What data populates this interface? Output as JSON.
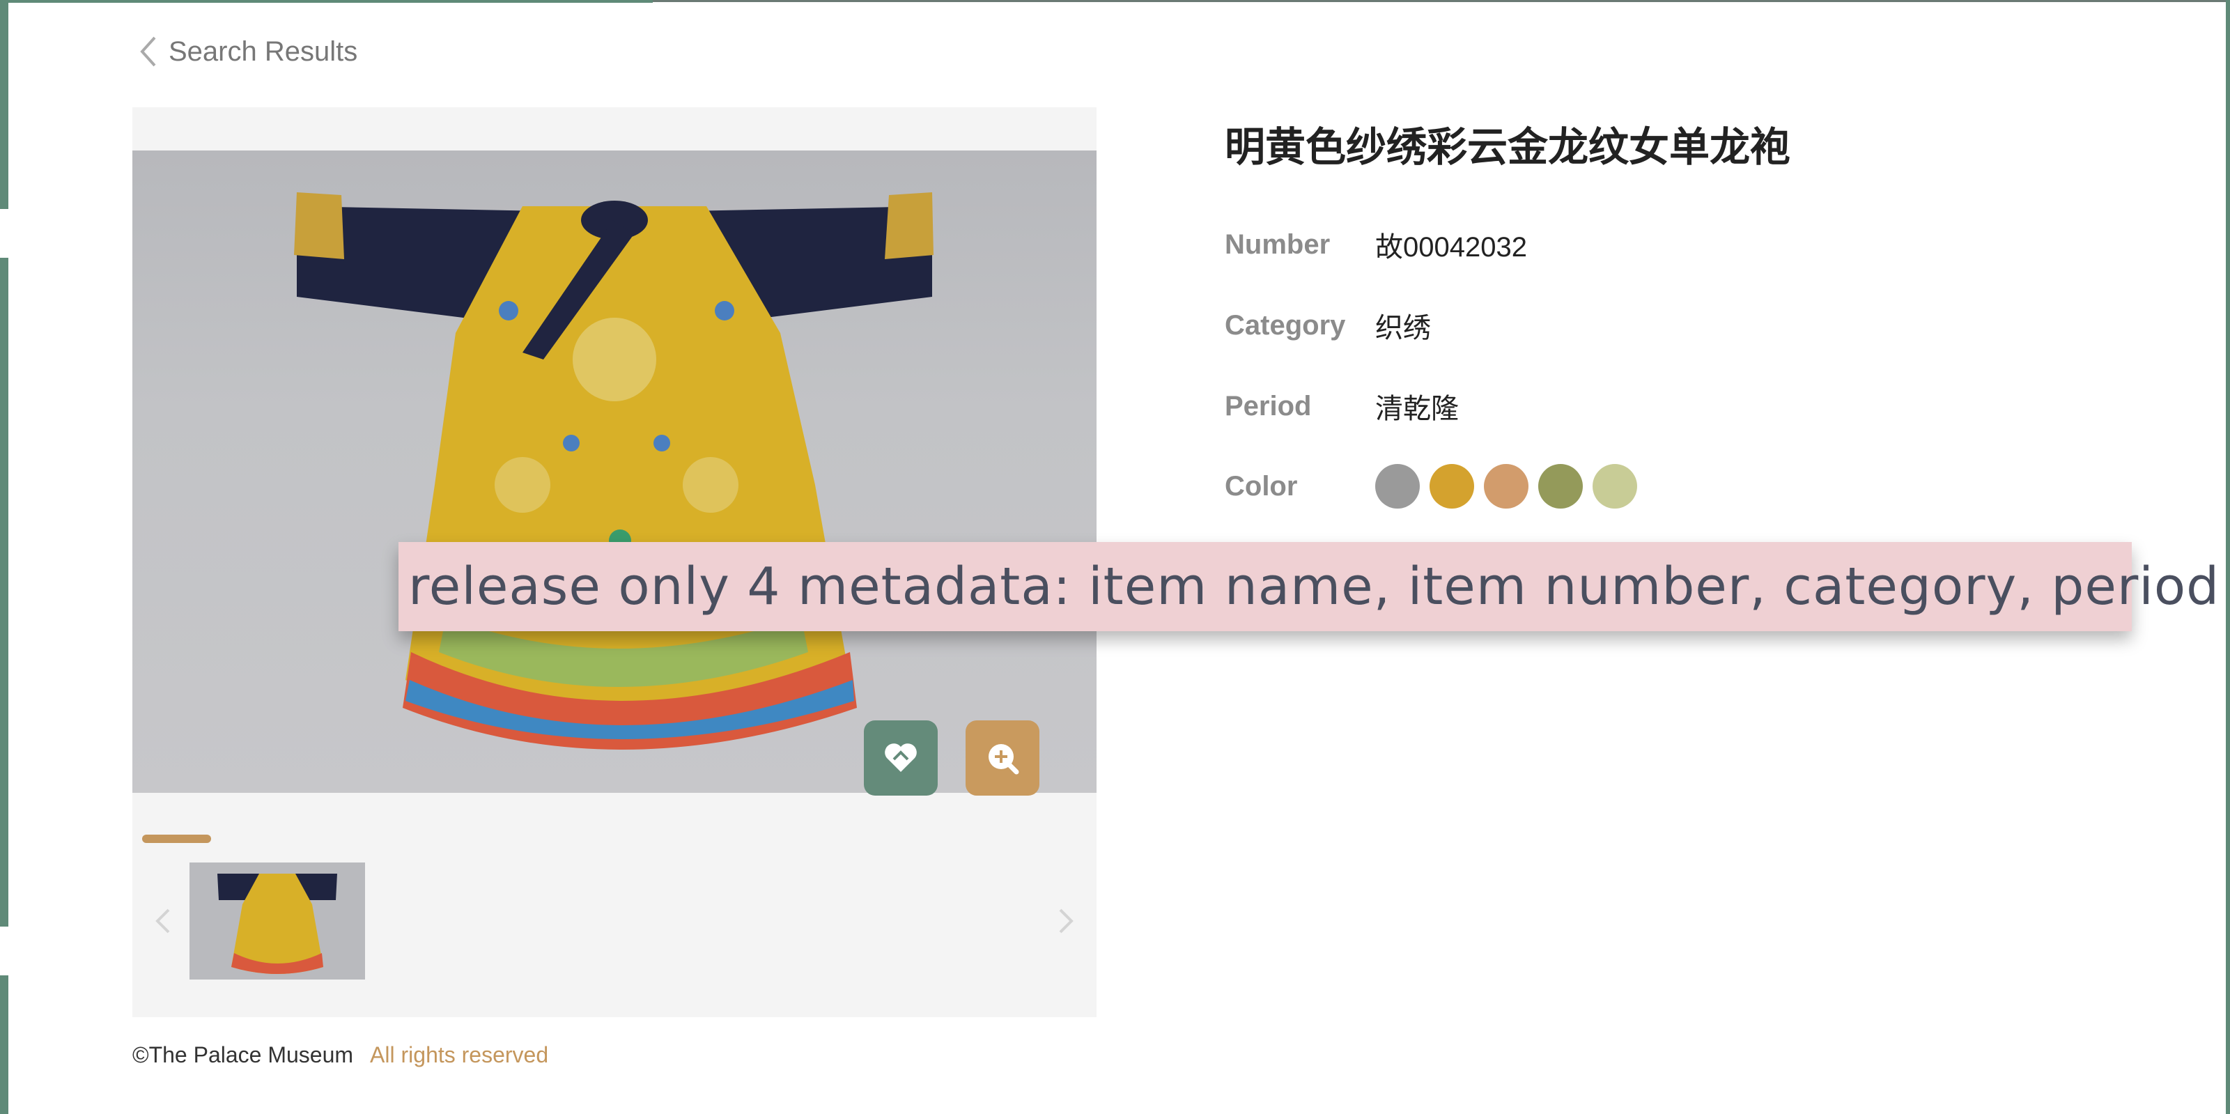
{
  "nav": {
    "back_label": "Search Results"
  },
  "item": {
    "title": "明黄色纱绣彩云金龙纹女单龙袍",
    "number_label": "Number",
    "number_value": "故00042032",
    "category_label": "Category",
    "category_value": "织绣",
    "period_label": "Period",
    "period_value": "清乾隆",
    "color_label": "Color",
    "colors": [
      "#9a9a9a",
      "#d4a22e",
      "#d29c6c",
      "#949a5a",
      "#c8cc96"
    ]
  },
  "gallery": {
    "progress_fraction": 0.08,
    "thumbnail_count": 1,
    "favorite_icon": "heart-icon",
    "zoom_icon": "zoom-in-icon"
  },
  "footer": {
    "copyright": "©The Palace Museum",
    "rights": "All rights reserved"
  },
  "annotation": {
    "text": "release only 4 metadata:  item name, item number, category, period"
  }
}
